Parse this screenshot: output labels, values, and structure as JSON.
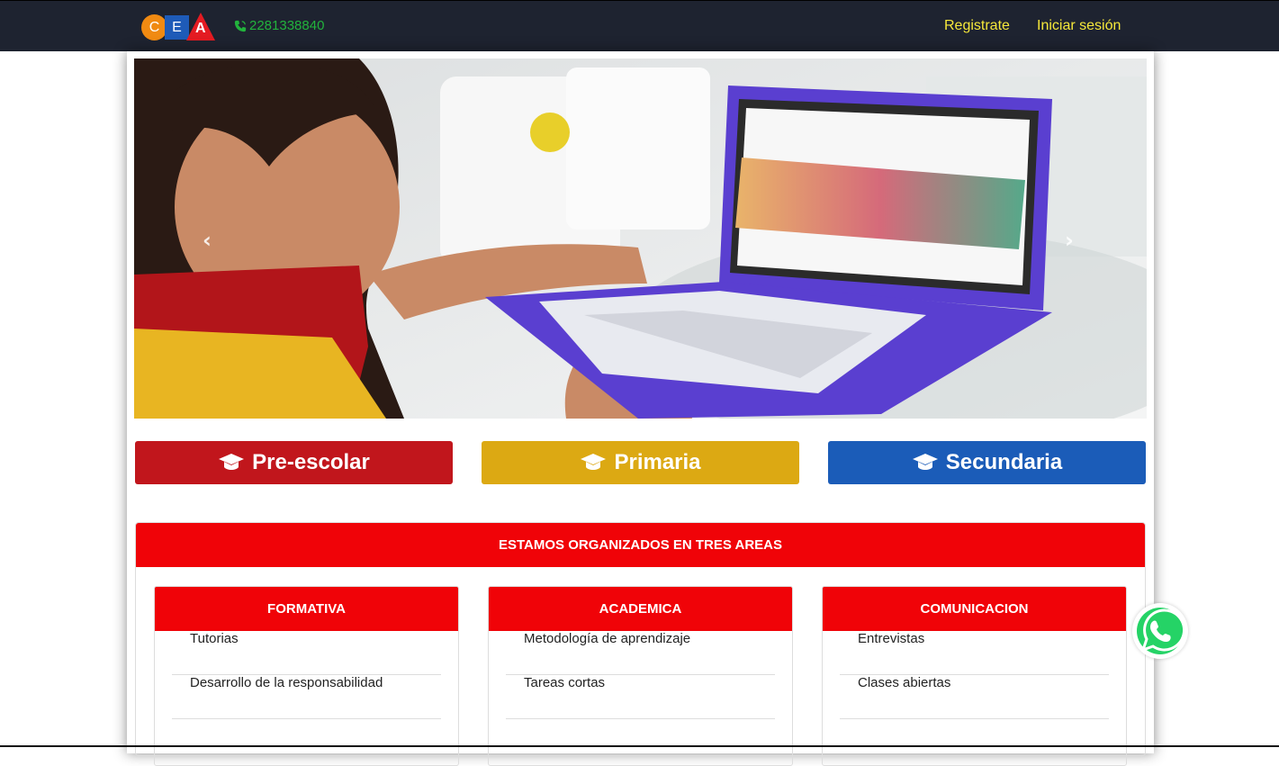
{
  "navbar": {
    "logo_letters": [
      "C",
      "E",
      "A"
    ],
    "phone": "2281338840",
    "register_label": "Registrate",
    "login_label": "Iniciar sesión",
    "colors": {
      "background": "#1e2330",
      "phone": "#22b33c",
      "links": "#f6e83a"
    }
  },
  "carousel": {
    "prev_icon": "chevron-left-icon",
    "next_icon": "chevron-right-icon",
    "prev_glyph": "‹",
    "next_glyph": "›"
  },
  "levels": [
    {
      "label": "Pre-escolar",
      "icon": "graduation-cap-icon",
      "color": "#c1161c"
    },
    {
      "label": "Primaria",
      "icon": "graduation-cap-icon",
      "color": "#dca913"
    },
    {
      "label": "Secundaria",
      "icon": "graduation-cap-icon",
      "color": "#1b5cb8"
    }
  ],
  "areas": {
    "title": "ESTAMOS ORGANIZADOS EN TRES AREAS",
    "accent": "#f00308",
    "cards": [
      {
        "title": "FORMATIVA",
        "items": [
          "Tutorias",
          "Desarrollo de la responsabilidad"
        ]
      },
      {
        "title": "ACADEMICA",
        "items": [
          "Metodología de aprendizaje",
          "Tareas cortas"
        ]
      },
      {
        "title": "COMUNICACION",
        "items": [
          "Entrevistas",
          "Clases abiertas"
        ]
      }
    ]
  },
  "whatsapp": {
    "icon": "whatsapp-icon",
    "color": "#25d366"
  }
}
